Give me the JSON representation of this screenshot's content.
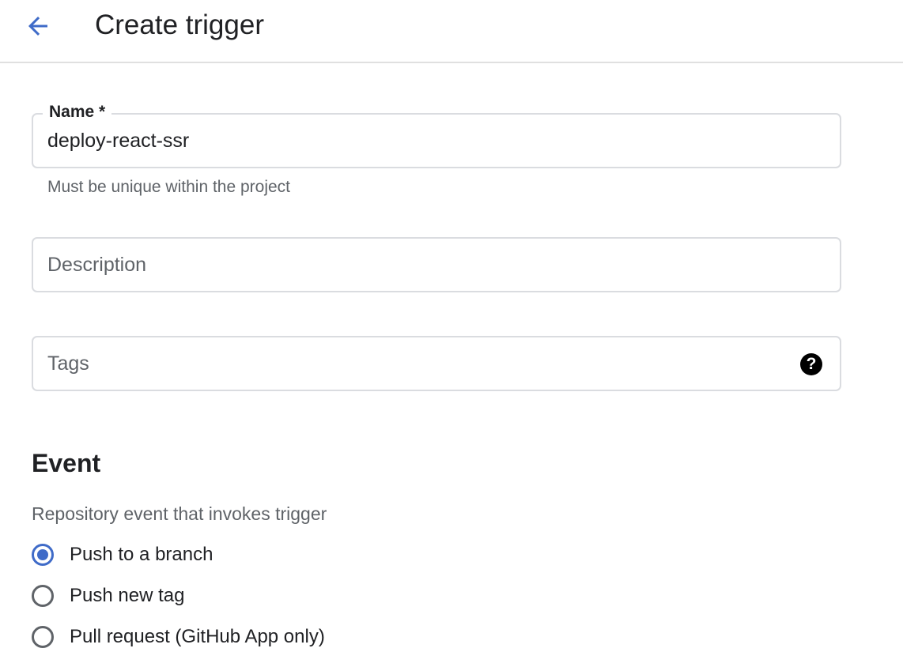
{
  "header": {
    "title": "Create trigger"
  },
  "form": {
    "name": {
      "label": "Name *",
      "value": "deploy-react-ssr",
      "hint": "Must be unique within the project"
    },
    "description": {
      "placeholder": "Description",
      "value": ""
    },
    "tags": {
      "placeholder": "Tags",
      "value": "",
      "help_icon": "help-circle-icon",
      "help_symbol": "?"
    }
  },
  "event": {
    "title": "Event",
    "subtitle": "Repository event that invokes trigger",
    "options": [
      {
        "label": "Push to a branch",
        "selected": true
      },
      {
        "label": "Push new tag",
        "selected": false
      },
      {
        "label": "Pull request (GitHub App only)",
        "selected": false
      }
    ]
  },
  "colors": {
    "accent": "#3f6bc8",
    "border": "#dadce0",
    "secondary_text": "#5f6368"
  }
}
